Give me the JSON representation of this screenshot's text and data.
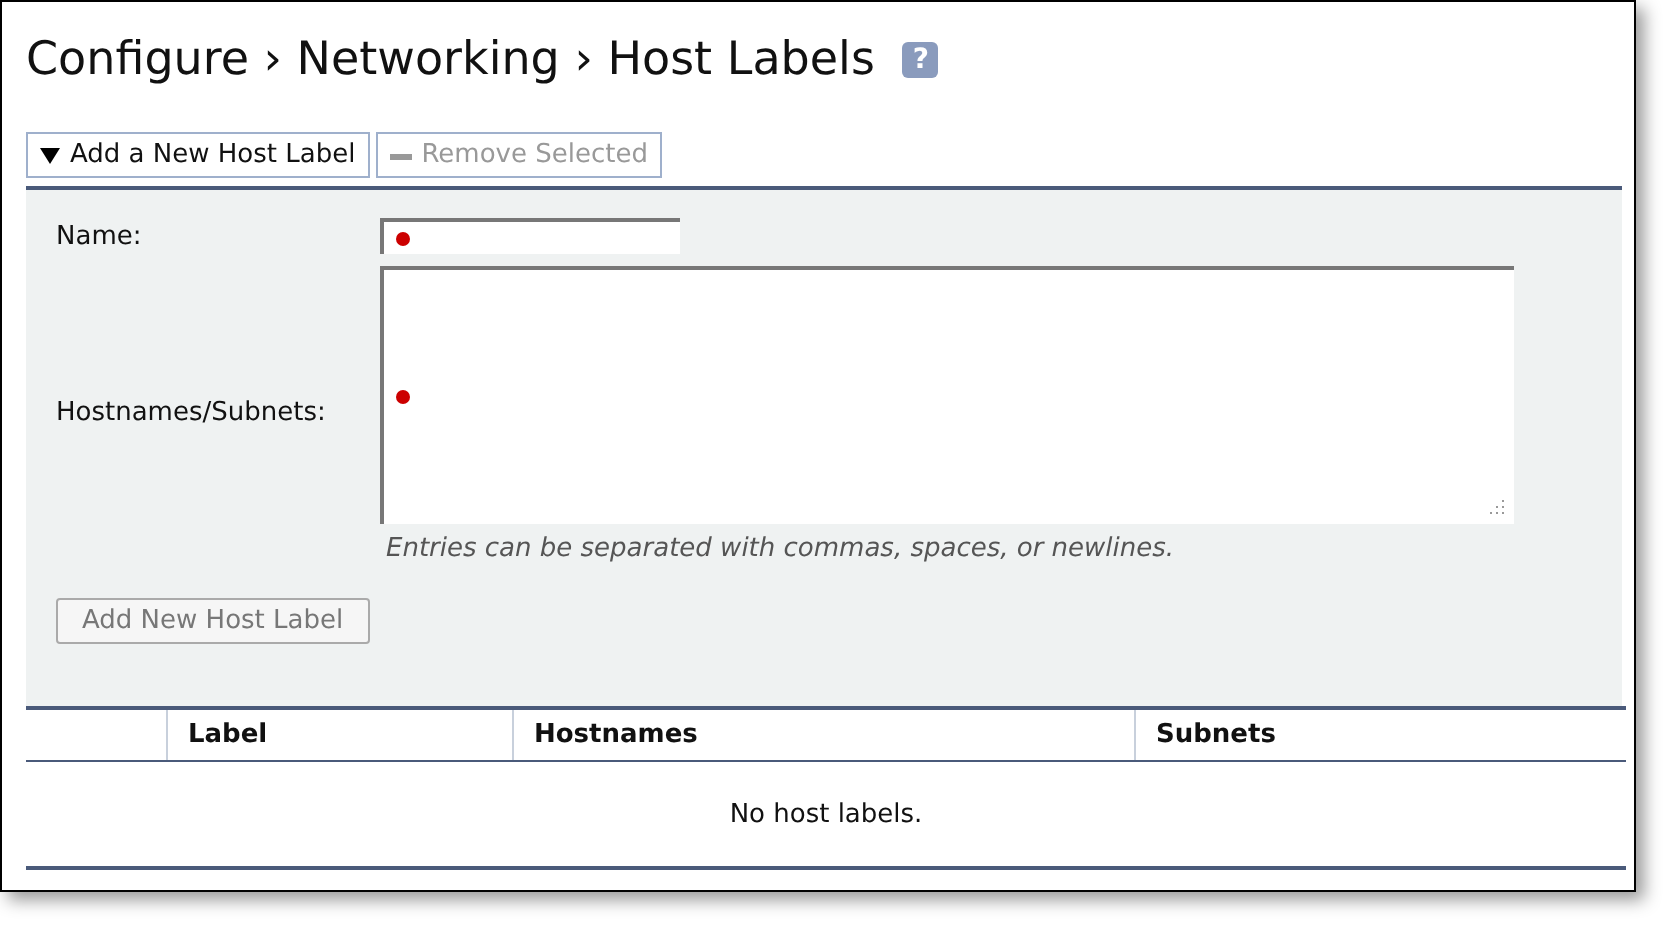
{
  "title": "Configure › Networking › Host Labels",
  "help": "?",
  "toolbar": [
    {
      "label": "Add a New Host Label",
      "kind": "toggle",
      "expanded": true,
      "disabled": false
    },
    {
      "label": "Remove Selected",
      "kind": "remove",
      "disabled": true
    }
  ],
  "form": {
    "fields": [
      {
        "label": "Name:",
        "kind": "input",
        "required": true
      },
      {
        "label": "Hostnames/Subnets:",
        "kind": "textarea",
        "required": true,
        "hint": "Entries can be separated with commas, spaces, or newlines."
      }
    ],
    "submit": {
      "label": "Add New Host Label",
      "disabled": true
    }
  },
  "table": {
    "columns": [
      "",
      "Label",
      "Hostnames",
      "Subnets"
    ],
    "empty": "No host labels."
  }
}
